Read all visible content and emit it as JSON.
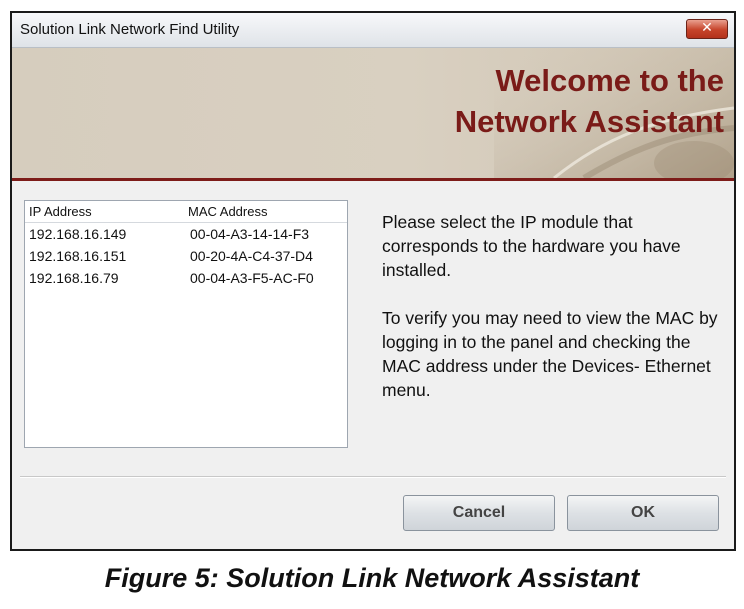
{
  "window": {
    "title": "Solution Link Network Find Utility",
    "close_label": "✕"
  },
  "banner": {
    "line1": "Welcome to the",
    "line2": "Network Assistant"
  },
  "device_list": {
    "columns": [
      "IP Address",
      "MAC Address"
    ],
    "rows": [
      {
        "ip": "192.168.16.149",
        "mac": "00-04-A3-14-14-F3"
      },
      {
        "ip": "192.168.16.151",
        "mac": "00-20-4A-C4-37-D4"
      },
      {
        "ip": "192.168.16.79",
        "mac": "00-04-A3-F5-AC-F0"
      }
    ]
  },
  "instructions": {
    "paragraph1": "Please select the IP module that corresponds to the hardware you have installed.",
    "paragraph2": "To verify you may need to  view the MAC by logging in to the panel and checking the MAC address under the Devices- Ethernet menu."
  },
  "buttons": {
    "cancel": "Cancel",
    "ok": "OK"
  },
  "caption": "Figure 5: Solution Link Network Assistant",
  "colors": {
    "accent": "#7a1b18",
    "banner_bg": "#d6cdbe"
  }
}
